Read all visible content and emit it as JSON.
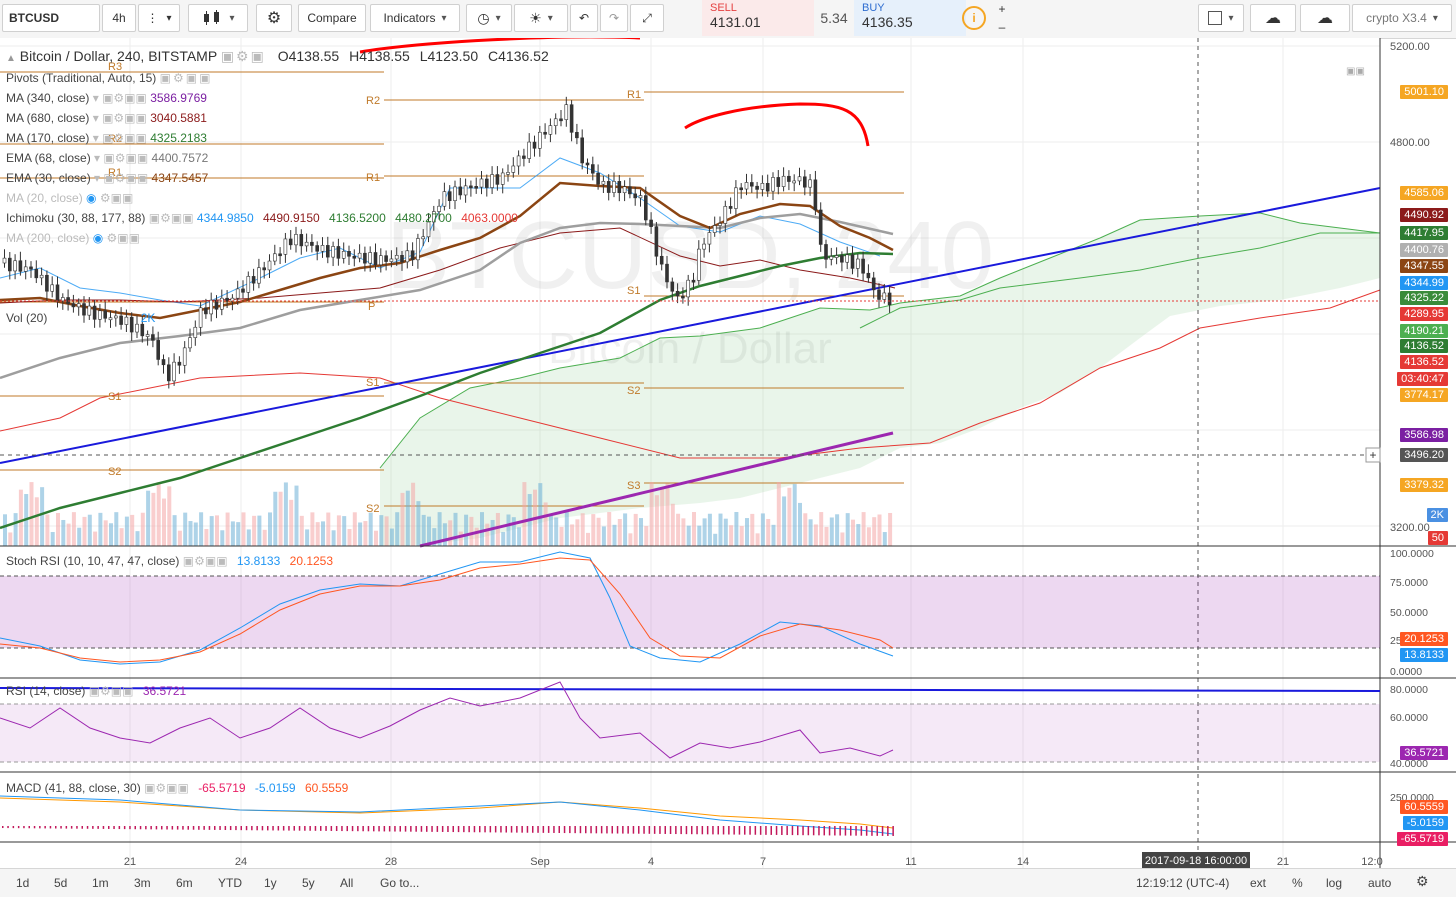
{
  "toolbar": {
    "symbol": "BTCUSD",
    "interval": "4h",
    "compare": "Compare",
    "indicators": "Indicators",
    "sell_label": "SELL",
    "sell_price": "4131.01",
    "spread": "5.34",
    "buy_label": "BUY",
    "buy_price": "4136.35",
    "layout_name": "crypto X3.4"
  },
  "main_legend": {
    "title": "Bitcoin / Dollar, 240, BITSTAMP",
    "o": "O4138.55",
    "h": "H4138.55",
    "l": "L4123.50",
    "c": "C4136.52",
    "pivots": "Pivots (Traditional, Auto, 15)",
    "ma340": "MA (340, close)",
    "ma340_v": "3586.9769",
    "ma680": "MA (680, close)",
    "ma680_v": "3040.5881",
    "ma170": "MA (170, close)",
    "ma170_v": "4325.2183",
    "ema68": "EMA (68, close)",
    "ema68_v": "4400.7572",
    "ema30": "EMA (30, close)",
    "ema30_v": "4347.5457",
    "ma20": "MA (20, close)",
    "ichimoku": "Ichimoku (30, 88, 177, 88)",
    "ich_v1": "4344.9850",
    "ich_v2": "4490.9150",
    "ich_v3": "4136.5200",
    "ich_v4": "4480.2700",
    "ich_v5": "4063.0000",
    "ma200": "MA (200, close)",
    "vol": "Vol (20)",
    "vol_v": "2K"
  },
  "watermark": {
    "symbol": "BTCUSD, 240",
    "name": "Bitcoin / Dollar"
  },
  "pivot_labels": [
    "R3",
    "R2",
    "R1",
    "P",
    "S1",
    "S2",
    "R2",
    "R1",
    "S1",
    "S2",
    "R1",
    "S1",
    "S2",
    "S3"
  ],
  "price_axis": {
    "ticks": [
      "5200.00",
      "4800.00",
      "3200.00"
    ],
    "badges": [
      {
        "v": "5001.10",
        "c": "#f5a623"
      },
      {
        "v": "4585.06",
        "c": "#f5a623"
      },
      {
        "v": "4490.92",
        "c": "#8b1a1a"
      },
      {
        "v": "4417.95",
        "c": "#2e7d32"
      },
      {
        "v": "4400.76",
        "c": "#b0b0b0"
      },
      {
        "v": "4347.55",
        "c": "#8b4513"
      },
      {
        "v": "4344.99",
        "c": "#2196f3"
      },
      {
        "v": "4325.22",
        "c": "#3a8b3a"
      },
      {
        "v": "4289.95",
        "c": "#e53935"
      },
      {
        "v": "4190.21",
        "c": "#4caf50"
      },
      {
        "v": "4136.52",
        "c": "#2e7d32"
      },
      {
        "v": "4136.52",
        "c": "#e53935"
      },
      {
        "v": "03:40:47",
        "c": "#e53935"
      },
      {
        "v": "3774.17",
        "c": "#f5a623"
      },
      {
        "v": "3586.98",
        "c": "#7b1fa2"
      },
      {
        "v": "3496.20",
        "c": "#555555"
      },
      {
        "v": "3379.32",
        "c": "#f5a623"
      },
      {
        "v": "2K",
        "c": "#4a90e2"
      },
      {
        "v": "50",
        "c": "#e53935"
      }
    ]
  },
  "stoch": {
    "title": "Stoch RSI (10, 10, 47, 47, close)",
    "v1": "13.8133",
    "v2": "20.1253",
    "ticks": [
      "100.0000",
      "75.0000",
      "50.0000",
      "25.0000",
      "0.0000"
    ],
    "b1": "20.1253",
    "b2": "13.8133"
  },
  "rsi": {
    "title": "RSI (14, close)",
    "v": "36.5721",
    "ticks": [
      "80.0000",
      "60.0000",
      "40.0000"
    ],
    "b": "36.5721"
  },
  "macd": {
    "title": "MACD (41, 88, close, 30)",
    "v1": "-65.5719",
    "v2": "-5.0159",
    "v3": "60.5559",
    "tick": "250.0000",
    "b1": "60.5559",
    "b2": "-5.0159",
    "b3": "-65.5719"
  },
  "time_axis": [
    "21",
    "24",
    "28",
    "Sep",
    "4",
    "7",
    "11",
    "14",
    "21",
    "12:0"
  ],
  "crosshair_time": "2017-09-18 16:00:00",
  "bottom": {
    "ranges": [
      "1d",
      "5d",
      "1m",
      "3m",
      "6m",
      "YTD",
      "1y",
      "5y",
      "All",
      "Go to..."
    ],
    "clock": "12:19:12 (UTC-4)",
    "ext": "ext",
    "pct": "%",
    "log": "log",
    "auto": "auto"
  }
}
